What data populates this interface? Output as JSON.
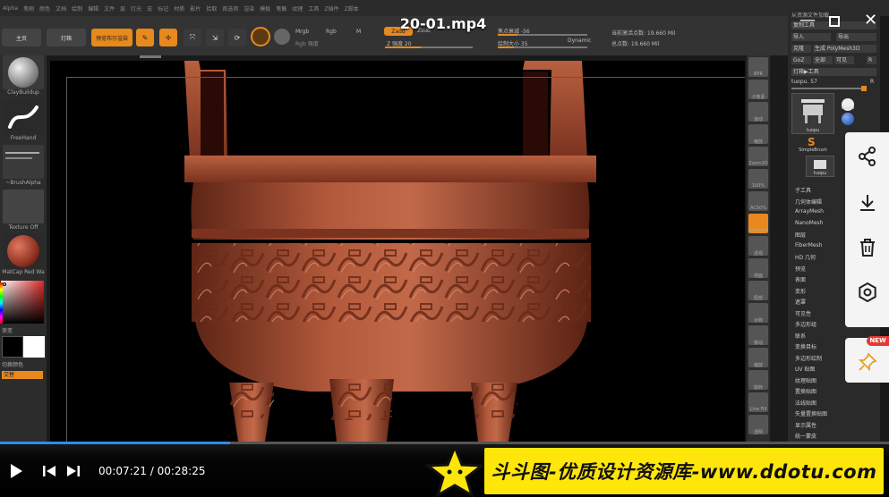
{
  "video": {
    "title": "20-01.mp4",
    "current_time": "00:07:21",
    "total_time": "00:28:25",
    "progress": 0.2587
  },
  "menubar": [
    "Alpha",
    "笔刷",
    "颜色",
    "文档",
    "绘制",
    "编辑",
    "文件",
    "层",
    "灯光",
    "宏",
    "标记",
    "材质",
    "影片",
    "拾取",
    "首选项",
    "渲染",
    "模板",
    "笔触",
    "纹理",
    "工具",
    "Z插件",
    "Z脚本"
  ],
  "toolbar": {
    "home": "主页",
    "lightbox": "灯箱",
    "preview_render": "预览布尔渲染",
    "edit": "Edit",
    "draw": "绘制",
    "move": "移动",
    "scale": "缩放",
    "rotate": "旋转",
    "mrgb": "Mrgb",
    "rgb": "Rgb",
    "m": "M",
    "rgb_intensity": "Rgb 强度",
    "zadd": "Zadd",
    "zsub": "Zsub",
    "z_intensity": "Z 强度 20",
    "focal_shift": "焦点衰减 -56",
    "draw_size": "绘制大小 35",
    "dynamic": "Dynamic",
    "active_points": "当前激活点数: 19.660 Mil",
    "total_points": "总点数: 19.660 Mil"
  },
  "left_palette": {
    "brush": "ClayBuildup",
    "stroke": "FreeHand",
    "alpha": "~BrushAlpha",
    "texture": "Texture Off",
    "material": "MatCap Red Wa",
    "gradient": "渐变",
    "switch_color": "切换颜色",
    "alternate": "交替"
  },
  "right_strip": [
    "BPR",
    "子像素",
    "滚动",
    "缩放",
    "Zoom2D",
    "100%",
    "AC50%",
    "Dynamic",
    "透视",
    "地面",
    "局部",
    "对称",
    "移动",
    "缩放",
    "旋转",
    "Line Fill",
    "透明"
  ],
  "tool_panel": {
    "header": "从资源文件加载",
    "copy_tool": "复制工具",
    "import": "导入",
    "export": "导出",
    "clone": "克隆",
    "make_polymesh": "生成 PolyMesh3D",
    "goz": "GoZ",
    "all": "全部",
    "visible": "可见",
    "r": "R",
    "lightbox_tools": "灯箱▶工具",
    "current_tool": "tuopu. 57",
    "thumb_names": [
      "tuopu",
      "tuopu",
      "SimpleBrush",
      "tuopu"
    ],
    "subpalettes": [
      "子工具",
      "几何体编辑",
      "ArrayMesh",
      "NanoMesh",
      "图层",
      "FiberMesh",
      "HD 几何",
      "预览",
      "表面",
      "变形",
      "遮罩",
      "可见性",
      "多边形组",
      "联系",
      "变换目标",
      "多边形绘制",
      "UV 贴图",
      "纹理贴图",
      "置换贴图",
      "法线贴图",
      "矢量置换贴图",
      "显示属性",
      "统一蒙皮"
    ]
  },
  "side_actions": {
    "badge": "NEW",
    "icons": [
      "share-icon",
      "download-icon",
      "trash-icon",
      "settings-icon",
      "pin-icon"
    ]
  },
  "watermark": {
    "text": "斗斗图-优质设计资源库-www.ddotu.com"
  },
  "colors": {
    "accent_orange": "#e8891d",
    "progress_blue": "#2f8bff",
    "watermark_yellow": "#ffe60a",
    "model_red": "#a0452d"
  }
}
